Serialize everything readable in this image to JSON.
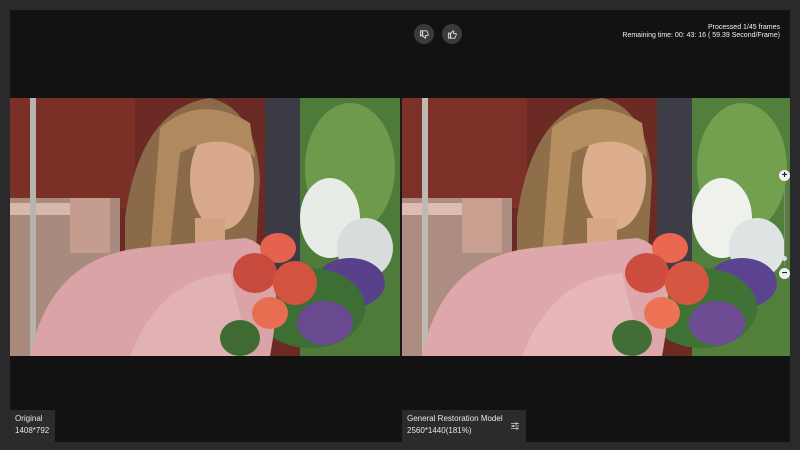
{
  "status": {
    "processed": "Processed 1/45 frames",
    "remaining": "Remaining time: 00: 43: 16 ( 59.39 Second/Frame)"
  },
  "feedback": {
    "dislike_icon": "thumbs-down-icon",
    "like_icon": "thumbs-up-icon"
  },
  "zoom": {
    "in_label": "+",
    "out_label": "−"
  },
  "original": {
    "name": "Original",
    "resolution": "1408*792"
  },
  "result": {
    "model": "General Restoration Model",
    "resolution": "2560*1440(181%)",
    "settings_icon": "sliders-icon"
  },
  "colors": {
    "background": "#121212",
    "frame_border": "#2a2a2c",
    "label_bg": "#2b2b2e",
    "button_bg": "#3a3a3d"
  }
}
